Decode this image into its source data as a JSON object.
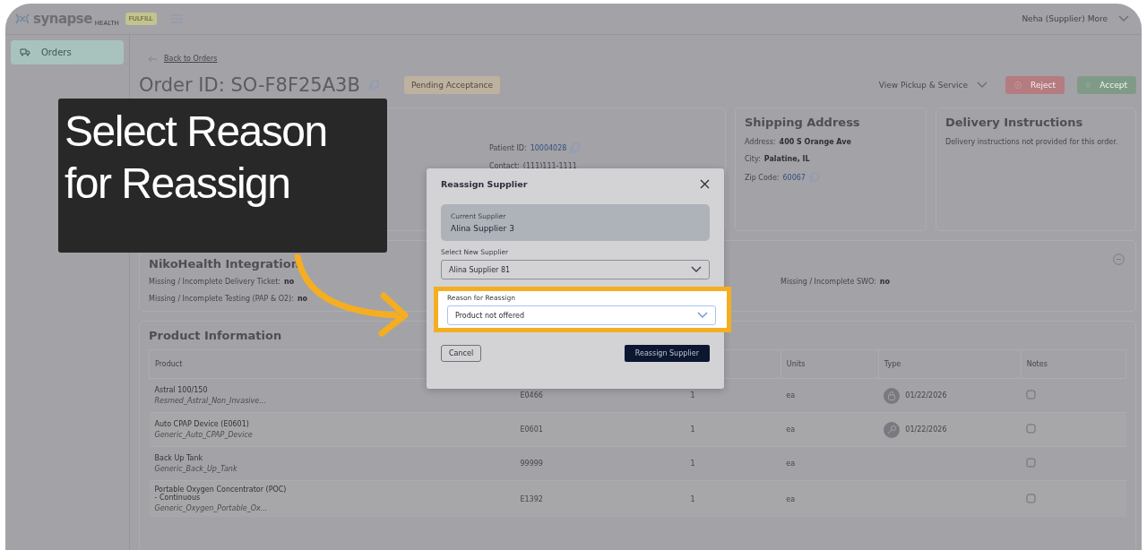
{
  "brand": {
    "name": "synapse",
    "sub": "HEALTH",
    "badge": "FULFILL"
  },
  "user_menu": "Neha (Supplier) More",
  "sidebar": {
    "items": [
      {
        "label": "Orders",
        "selected": true
      }
    ]
  },
  "back_link": "Back to Orders",
  "order": {
    "title": "Order ID: SO-F8F25A3B",
    "status": "Pending Acceptance",
    "actions_menu": "View Pickup & Service",
    "buttons": [
      {
        "label": "Reject",
        "kind": "reject"
      },
      {
        "label": "Accept",
        "kind": "accept"
      }
    ]
  },
  "patient_card": {
    "fields": [
      {
        "label": "Patient ID:",
        "value": "10004028",
        "copy": true
      },
      {
        "label": "Contact:",
        "value": "(111)111-1111",
        "copy": false
      }
    ]
  },
  "shipping_address": {
    "title": "Shipping Address",
    "fields": [
      {
        "label": "Address:",
        "value": "400 S Orange Ave",
        "kind": "text"
      },
      {
        "label": "City:",
        "value": "Palatine, IL",
        "kind": "text"
      },
      {
        "label": "Zip Code:",
        "value": "60067",
        "kind": "link"
      }
    ]
  },
  "delivery_instructions": {
    "title": "Delivery Instructions",
    "text": "Delivery instructions not provided for this order."
  },
  "integration": {
    "title": "NikoHealth Integration",
    "items": [
      {
        "label": "Missing / Incomplete Delivery Ticket:",
        "value": "no"
      },
      {
        "label": "Missing / Incomplete Testing (PAP & O2):",
        "value": "no"
      },
      {
        "label": "Missing / Incomplete SWO:",
        "value": "no"
      }
    ]
  },
  "products": {
    "title": "Product Information",
    "columns": [
      {
        "label": "Product"
      },
      {},
      {},
      {
        "label": "Units"
      },
      {
        "label": "Type"
      },
      {
        "label": "Notes"
      }
    ],
    "rows": [
      {
        "name": "Astral 100/150",
        "subtitle": "Resmed_Astral_Non_Invasive...",
        "code": "E0466",
        "qty": "1",
        "units": "ea",
        "type": {
          "kind": "lock",
          "date": "01/22/2026"
        }
      },
      {
        "name": "Auto CPAP Device (E0601)",
        "subtitle": "Generic_Auto_CPAP_Device",
        "code": "E0601",
        "qty": "1",
        "units": "ea",
        "type": {
          "kind": "key",
          "date": "01/22/2026"
        }
      },
      {
        "name": "Back Up Tank",
        "subtitle": "Generic_Back_Up_Tank",
        "code": "99999",
        "qty": "1",
        "units": "ea"
      },
      {
        "name": "Portable Oxygen Concentrator (POC) - Continuous",
        "subtitle": "Generic_Oxygen_Portable_Ox...",
        "code": "E1392",
        "qty": "1",
        "units": "ea"
      }
    ]
  },
  "modal": {
    "title": "Reassign Supplier",
    "current_label": "Current Supplier",
    "current_value": "Alina Supplier 3",
    "fields": [
      {
        "label": "Select New Supplier",
        "value": "Alina Supplier 81",
        "highlighted": false
      },
      {
        "label": "Reason for Reassign",
        "value": "Product not offered",
        "highlighted": true
      }
    ],
    "cancel": "Cancel",
    "submit": "Reassign Supplier"
  },
  "callout": {
    "lines": [
      "Select Reason",
      "for Reassign"
    ]
  }
}
